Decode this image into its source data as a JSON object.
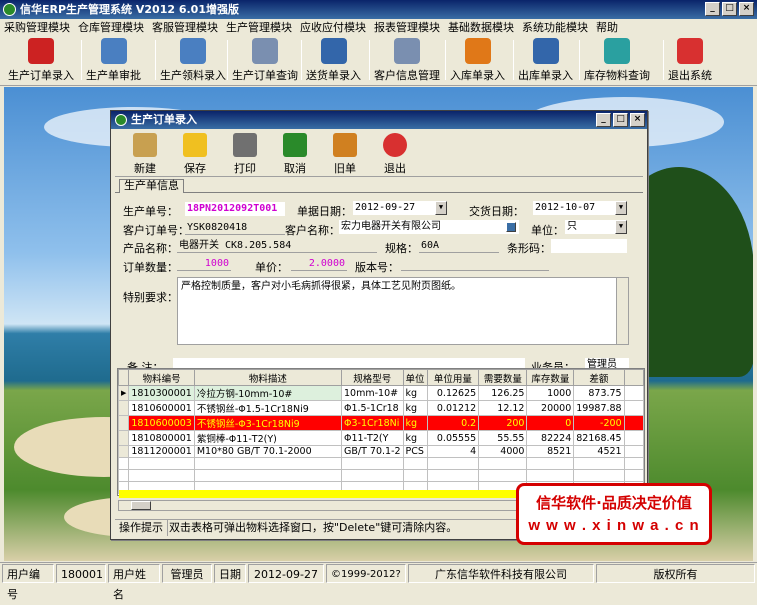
{
  "app": {
    "title": "信华ERP生产管理系统  V2012  6.01增强版"
  },
  "menu": [
    "采购管理模块",
    "仓库管理模块",
    "客服管理模块",
    "生产管理模块",
    "应收应付模块",
    "报表管理模块",
    "基础数据模块",
    "系统功能模块",
    "帮助"
  ],
  "toolbar": [
    {
      "label": "生产订单录入",
      "icon": "pdf-icon",
      "color": "#cc2222"
    },
    {
      "label": "生产单审批",
      "icon": "brush-icon",
      "color": "#4a7fc1"
    },
    {
      "label": "生产领料录入",
      "icon": "brush-icon",
      "color": "#4a7fc1"
    },
    {
      "label": "生产订单查询",
      "icon": "document-icon",
      "color": "#7a8fb0"
    },
    {
      "label": "送货单录入",
      "icon": "pen-icon",
      "color": "#3366aa"
    },
    {
      "label": "客户信息管理",
      "icon": "document-icon",
      "color": "#7a8fb0"
    },
    {
      "label": "入库单录入",
      "icon": "star-icon",
      "color": "#e07818"
    },
    {
      "label": "出库单录入",
      "icon": "bookmark-icon",
      "color": "#3366aa"
    },
    {
      "label": "库存物料查询",
      "icon": "feather-icon",
      "color": "#2aa0a0"
    },
    {
      "label": "退出系统",
      "icon": "power-icon",
      "color": "#d83030"
    }
  ],
  "child": {
    "title": "生产订单录入",
    "toolbar": [
      {
        "label": "新建",
        "icon": "clipboard-icon"
      },
      {
        "label": "保存",
        "icon": "floppy-icon"
      },
      {
        "label": "打印",
        "icon": "printer-icon"
      },
      {
        "label": "取消",
        "icon": "undo-icon"
      },
      {
        "label": "旧单",
        "icon": "package-icon"
      },
      {
        "label": "退出",
        "icon": "power-icon"
      }
    ],
    "tab": "生产单信息",
    "form": {
      "order_no_label": "生产单号：",
      "order_no": "18PN2012092T001",
      "doc_date_label": "单据日期：",
      "doc_date": "2012-09-27",
      "delivery_date_label": "交货日期：",
      "delivery_date": "2012-10-07",
      "cust_order_label": "客户订单号：",
      "cust_order": "YSK0820418",
      "cust_name_label": "客户名称：",
      "cust_name": "宏力电器开关有限公司",
      "unit_label": "单位：",
      "unit": "只",
      "product_label": "产品名称：",
      "product": "电器开关 CK8.205.584",
      "spec_label": "规格：",
      "spec": "60A",
      "barcode_label": "条形码：",
      "barcode": "",
      "qty_label": "订单数量：",
      "qty": "1000",
      "price_label": "单价：",
      "price": "2.0000",
      "version_label": "版本号：",
      "version": "",
      "req_label": "特别要求：",
      "req": "严格控制质量，客户对小毛病抓得很紧，具体工艺见附页图纸。",
      "remark_label": "备  注：",
      "remark": "",
      "clerk_label": "业务员：",
      "clerk": "管理员"
    },
    "grid": {
      "headers": [
        "物料编号",
        "物料描述",
        "规格型号",
        "单位",
        "单位用量",
        "需要数量",
        "库存数量",
        "差额"
      ],
      "rows": [
        [
          "1810300001",
          "冷拉方钢-10mm-10#",
          "10mm-10#",
          "kg",
          "0.12625",
          "126.25",
          "1000",
          "873.75"
        ],
        [
          "1810600001",
          "不锈钢丝-Φ1.5-1Cr18Ni9",
          "Φ1.5-1Cr18",
          "kg",
          "0.01212",
          "12.12",
          "20000",
          "19987.88"
        ],
        [
          "1810600003",
          "不锈钢丝-Φ3-1Cr18Ni9",
          "Φ3-1Cr18Ni",
          "kg",
          "0.2",
          "200",
          "0",
          "-200"
        ],
        [
          "1810800001",
          "紫铜棒-Φ11-T2(Y)",
          "Φ11-T2(Y",
          "kg",
          "0.05555",
          "55.55",
          "82224",
          "82168.45"
        ],
        [
          "1811200001",
          "M10*80 GB/T 70.1-2000",
          "GB/T 70.1-2",
          "PCS",
          "4",
          "4000",
          "8521",
          "4521"
        ]
      ]
    },
    "hint_label": "操作提示",
    "hint": "双击表格可弹出物料选择窗口，按\"Delete\"键可清除内容。"
  },
  "watermark": {
    "line1": "信华软件·品质决定价值",
    "line2": "w w w . x i n w a . c n"
  },
  "status": {
    "user_no_label": "用户编号",
    "user_no": "180001",
    "user_name_label": "用户姓名",
    "user_name": "管理员",
    "date_label": "日期",
    "date": "2012-09-27",
    "copyright": "©1999-2012?",
    "company": "广东信华软件科技有限公司",
    "rights": "版权所有"
  }
}
